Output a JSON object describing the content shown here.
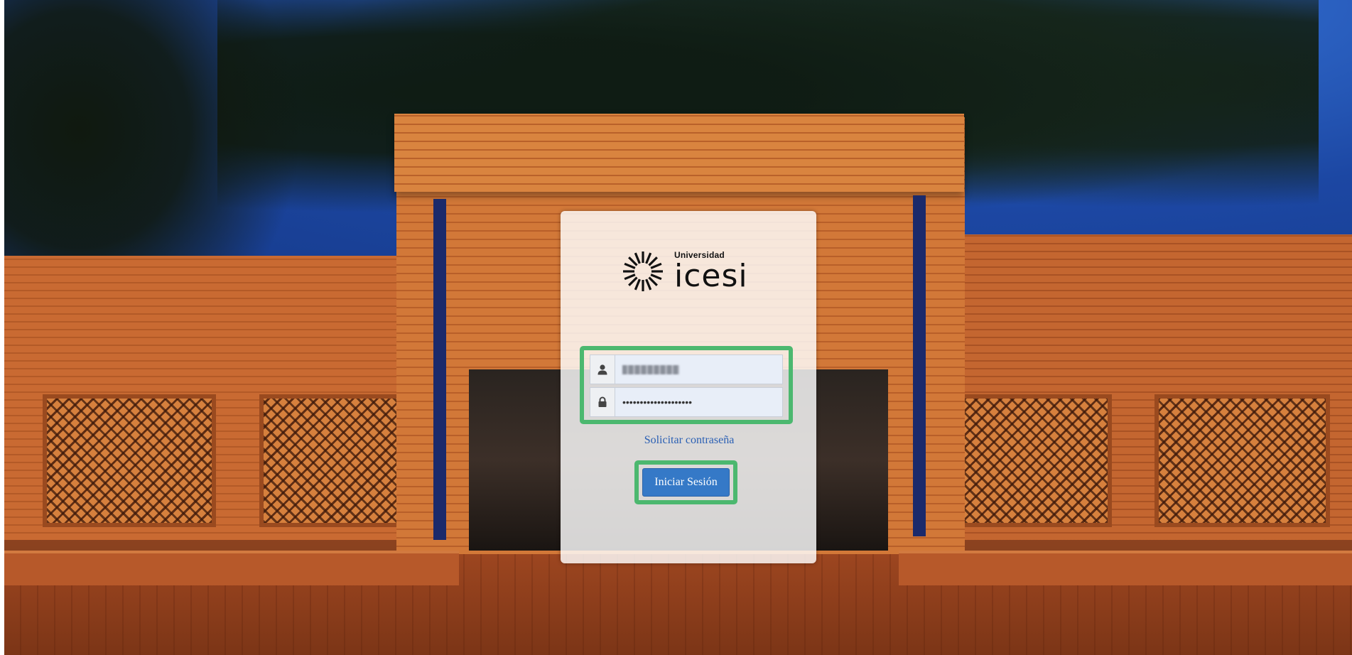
{
  "brand": {
    "small_text": "Universidad",
    "big_text": "icesi"
  },
  "login": {
    "username_icon": "user-icon",
    "password_icon": "lock-icon",
    "password_value": "••••••••••••••••••••",
    "request_password_link": "Solicitar contraseña",
    "submit_label": "Iniciar Sesión"
  },
  "colors": {
    "highlight_border": "#4cb86f",
    "button_bg": "#3579c7",
    "link": "#2a5fb4"
  }
}
